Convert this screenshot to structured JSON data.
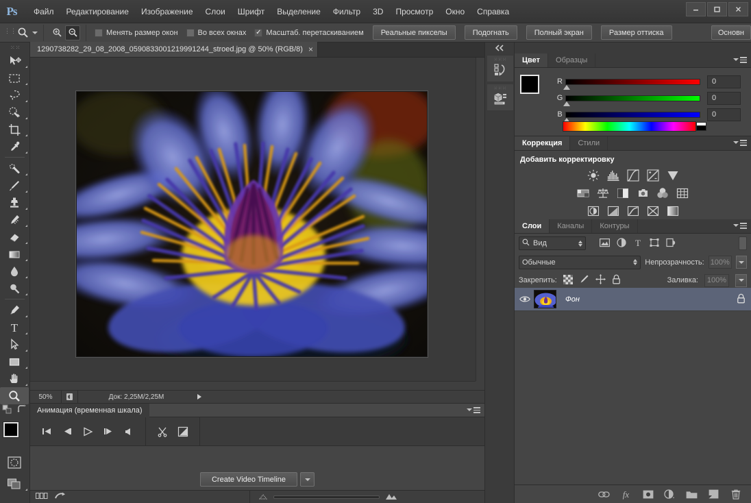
{
  "app": {
    "logo": "Ps"
  },
  "menubar": {
    "items": [
      {
        "label": "Файл",
        "name": "menu-file"
      },
      {
        "label": "Редактирование",
        "name": "menu-edit"
      },
      {
        "label": "Изображение",
        "name": "menu-image"
      },
      {
        "label": "Слои",
        "name": "menu-layers"
      },
      {
        "label": "Шрифт",
        "name": "menu-type"
      },
      {
        "label": "Выделение",
        "name": "menu-select"
      },
      {
        "label": "Фильтр",
        "name": "menu-filter"
      },
      {
        "label": "3D",
        "name": "menu-3d"
      },
      {
        "label": "Просмотр",
        "name": "menu-view"
      },
      {
        "label": "Окно",
        "name": "menu-window"
      },
      {
        "label": "Справка",
        "name": "menu-help"
      }
    ]
  },
  "window_controls": {
    "minimize": "minimize-icon",
    "maximize": "maximize-icon",
    "close": "close-icon"
  },
  "options_bar": {
    "tool_icon": "zoom-tool-icon",
    "zoom_in": "zoom-in-icon",
    "zoom_out": "zoom-out-icon",
    "checkboxes": [
      {
        "label": "Менять размер окон",
        "checked": false,
        "name": "resize-windows-checkbox"
      },
      {
        "label": "Во всех окнах",
        "checked": false,
        "name": "all-windows-checkbox"
      },
      {
        "label": "Масштаб. перетаскиванием",
        "checked": true,
        "name": "scrubby-zoom-checkbox"
      }
    ],
    "buttons": [
      {
        "label": "Реальные пикселы",
        "name": "actual-pixels-button"
      },
      {
        "label": "Подогнать",
        "name": "fit-screen-button"
      },
      {
        "label": "Полный экран",
        "name": "fill-screen-button"
      },
      {
        "label": "Размер оттиска",
        "name": "print-size-button"
      }
    ],
    "workspace_label": "Основн"
  },
  "toolbar": {
    "tools": [
      {
        "name": "move-tool",
        "icon": "move-icon",
        "has_flyout": true
      },
      {
        "name": "marquee-tool",
        "icon": "rectangular-marquee-icon",
        "has_flyout": true
      },
      {
        "name": "lasso-tool",
        "icon": "lasso-icon",
        "has_flyout": true
      },
      {
        "name": "quick-selection-tool",
        "icon": "quick-selection-icon",
        "has_flyout": true
      },
      {
        "name": "crop-tool",
        "icon": "crop-icon",
        "has_flyout": true
      },
      {
        "name": "eyedropper-tool",
        "icon": "eyedropper-icon",
        "has_flyout": true
      },
      {
        "name": "healing-brush-tool",
        "icon": "spot-healing-icon",
        "has_flyout": true
      },
      {
        "name": "brush-tool",
        "icon": "brush-icon",
        "has_flyout": true
      },
      {
        "name": "clone-stamp-tool",
        "icon": "clone-stamp-icon",
        "has_flyout": true
      },
      {
        "name": "history-brush-tool",
        "icon": "history-brush-icon",
        "has_flyout": true
      },
      {
        "name": "eraser-tool",
        "icon": "eraser-icon",
        "has_flyout": true
      },
      {
        "name": "gradient-tool",
        "icon": "gradient-icon",
        "has_flyout": true
      },
      {
        "name": "blur-tool",
        "icon": "blur-drop-icon",
        "has_flyout": true
      },
      {
        "name": "dodge-tool",
        "icon": "dodge-icon",
        "has_flyout": true
      },
      {
        "name": "pen-tool",
        "icon": "pen-icon",
        "has_flyout": true
      },
      {
        "name": "type-tool",
        "icon": "type-t-icon",
        "has_flyout": true
      },
      {
        "name": "path-selection-tool",
        "icon": "path-arrow-icon",
        "has_flyout": true
      },
      {
        "name": "shape-tool",
        "icon": "rectangle-shape-icon",
        "has_flyout": true
      },
      {
        "name": "hand-tool",
        "icon": "hand-icon",
        "has_flyout": true
      },
      {
        "name": "zoom-tool",
        "icon": "magnifier-icon",
        "has_flyout": false,
        "selected": true
      }
    ],
    "default-colors-icon": "default-colors-icon",
    "swap-colors-icon": "swap-colors-icon",
    "foreground_color": "#000000",
    "background_color": "#ffffff",
    "quick_mask_icon": "quick-mask-icon",
    "screen_mode_icon": "screen-mode-icon"
  },
  "document": {
    "tab_title": "1290738282_29_08_2008_0590833001219991244_stroed.jpg @ 50% (RGB/8)",
    "close_icon": "close-icon"
  },
  "status_bar": {
    "zoom": "50%",
    "doc_icon": "document-thumbnail-icon",
    "doc_info": "Док: 2,25M/2,25M",
    "expand_icon": "play-arrow-icon"
  },
  "animation_panel": {
    "title": "Анимация (временная шкала)",
    "menu_icon": "panel-menu-icon",
    "controls": [
      {
        "name": "go-to-first-frame-button",
        "icon": "skip-start-icon"
      },
      {
        "name": "previous-frame-button",
        "icon": "step-back-icon"
      },
      {
        "name": "play-button",
        "icon": "play-icon"
      },
      {
        "name": "next-frame-button",
        "icon": "step-forward-icon"
      },
      {
        "name": "audio-button",
        "icon": "speaker-icon"
      }
    ],
    "tools": [
      {
        "name": "split-clip-button",
        "icon": "scissors-icon"
      },
      {
        "name": "transition-button",
        "icon": "transition-icon"
      }
    ],
    "create_timeline_label": "Create Video Timeline",
    "create_timeline_dropdown_icon": "chevron-down-icon",
    "footer": {
      "frame_view_icon": "frames-view-icon",
      "convert_icon": "convert-to-frames-icon",
      "zoom_out_icon": "small-mountain-icon",
      "zoom_in_icon": "large-mountain-icon"
    }
  },
  "mini_dock": {
    "collapse_icon": "collapse-panels-icon",
    "items": [
      {
        "name": "history-panel-icon",
        "icon": "history-icon"
      },
      {
        "name": "3d-panel-icon",
        "icon": "cube-properties-icon"
      }
    ]
  },
  "color_panel": {
    "tabs": [
      {
        "label": "Цвет",
        "active": true,
        "name": "tab-color"
      },
      {
        "label": "Образцы",
        "active": false,
        "name": "tab-swatches"
      }
    ],
    "menu_icon": "panel-menu-icon",
    "foreground": "#000000",
    "background": "#ffffff",
    "sliders": [
      {
        "label": "R",
        "value": "0",
        "name": "red-slider",
        "from": "#000000",
        "to": "#ff0000"
      },
      {
        "label": "G",
        "value": "0",
        "name": "green-slider",
        "from": "#000000",
        "to": "#00ff00"
      },
      {
        "label": "B",
        "value": "0",
        "name": "blue-slider",
        "from": "#000000",
        "to": "#0000ff"
      }
    ],
    "spectrum_name": "color-spectrum-ramp"
  },
  "adjustments_panel": {
    "tabs": [
      {
        "label": "Коррекция",
        "active": true,
        "name": "tab-adjustments"
      },
      {
        "label": "Стили",
        "active": false,
        "name": "tab-styles"
      }
    ],
    "menu_icon": "panel-menu-icon",
    "title": "Добавить корректировку",
    "rows": [
      [
        {
          "name": "brightness-contrast-adjustment",
          "icon": "sun-icon"
        },
        {
          "name": "levels-adjustment",
          "icon": "levels-histogram-icon"
        },
        {
          "name": "curves-adjustment",
          "icon": "curves-icon"
        },
        {
          "name": "exposure-adjustment",
          "icon": "exposure-icon"
        },
        {
          "name": "vibrance-adjustment",
          "icon": "vibrance-triangle-icon"
        }
      ],
      [
        {
          "name": "hue-saturation-adjustment",
          "icon": "hue-saturation-icon"
        },
        {
          "name": "color-balance-adjustment",
          "icon": "balance-scale-icon"
        },
        {
          "name": "black-white-adjustment",
          "icon": "black-white-icon"
        },
        {
          "name": "photo-filter-adjustment",
          "icon": "photo-filter-icon"
        },
        {
          "name": "channel-mixer-adjustment",
          "icon": "channel-mixer-circles-icon"
        },
        {
          "name": "color-lookup-adjustment",
          "icon": "grid-lookup-icon"
        }
      ],
      [
        {
          "name": "invert-adjustment",
          "icon": "invert-icon"
        },
        {
          "name": "posterize-adjustment",
          "icon": "posterize-icon"
        },
        {
          "name": "threshold-adjustment",
          "icon": "threshold-icon"
        },
        {
          "name": "selective-color-adjustment",
          "icon": "selective-color-icon"
        },
        {
          "name": "gradient-map-adjustment",
          "icon": "gradient-map-icon"
        }
      ]
    ]
  },
  "layers_panel": {
    "tabs": [
      {
        "label": "Слои",
        "active": true,
        "name": "tab-layers"
      },
      {
        "label": "Каналы",
        "active": false,
        "name": "tab-channels"
      },
      {
        "label": "Контуры",
        "active": false,
        "name": "tab-paths"
      }
    ],
    "menu_icon": "panel-menu-icon",
    "filter": {
      "search_icon": "search-icon",
      "value": "Вид",
      "type_icons": [
        {
          "name": "filter-pixel-icon",
          "icon": "image-icon"
        },
        {
          "name": "filter-adjustment-icon",
          "icon": "half-circle-icon"
        },
        {
          "name": "filter-type-icon",
          "icon": "type-t-icon"
        },
        {
          "name": "filter-shape-icon",
          "icon": "shape-icon"
        },
        {
          "name": "filter-smart-object-icon",
          "icon": "smart-object-icon"
        }
      ],
      "toggle_name": "filter-enable-toggle"
    },
    "blend_mode": "Обычные",
    "opacity_label": "Непрозрачность:",
    "opacity_value": "100%",
    "lock_label": "Закрепить:",
    "lock_icons": [
      {
        "name": "lock-transparent-pixels-button",
        "icon": "checker-icon"
      },
      {
        "name": "lock-image-pixels-button",
        "icon": "brush-icon"
      },
      {
        "name": "lock-position-button",
        "icon": "move-arrows-icon"
      },
      {
        "name": "lock-all-button",
        "icon": "lock-icon"
      }
    ],
    "fill_label": "Заливка:",
    "fill_value": "100%",
    "layers": [
      {
        "name": "Фон",
        "visible": true,
        "locked": true,
        "eye_icon": "eye-icon",
        "lock_icon": "lock-icon",
        "thumbnail": "flower-thumbnail"
      }
    ],
    "footer_icons": [
      {
        "name": "link-layers-button",
        "icon": "link-icon"
      },
      {
        "name": "layer-style-button",
        "icon": "fx-icon"
      },
      {
        "name": "add-layer-mask-button",
        "icon": "mask-icon"
      },
      {
        "name": "new-fill-adjustment-button",
        "icon": "half-circle-icon"
      },
      {
        "name": "new-group-button",
        "icon": "folder-icon"
      },
      {
        "name": "new-layer-button",
        "icon": "new-layer-icon"
      },
      {
        "name": "delete-layer-button",
        "icon": "trash-icon"
      }
    ]
  }
}
